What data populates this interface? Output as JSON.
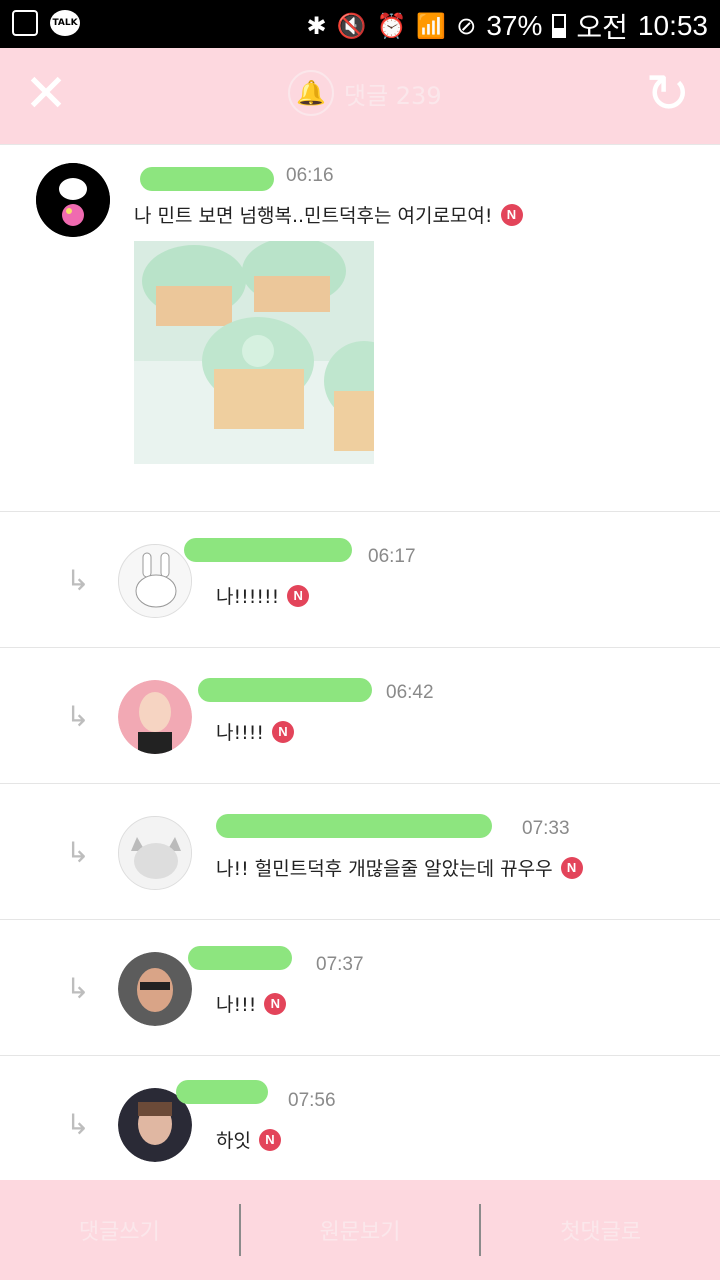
{
  "status_bar": {
    "battery": "37%",
    "ampm": "오전",
    "time": "10:53",
    "talk": "TALK"
  },
  "header": {
    "title": "댓글 239"
  },
  "comments": [
    {
      "time": "06:16",
      "text": "나 민트 보면 넘행복..민트덕후는 여기로모여!",
      "badge": "N"
    },
    {
      "time": "06:17",
      "text": "나!!!!!!",
      "badge": "N"
    },
    {
      "time": "06:42",
      "text": "나!!!!",
      "badge": "N"
    },
    {
      "time": "07:33",
      "text": "나!! 헐민트덕후 개많을줄 알았는데 뀨우우",
      "badge": "N"
    },
    {
      "time": "07:37",
      "text": "나!!!",
      "badge": "N"
    },
    {
      "time": "07:56",
      "text": "하잇",
      "badge": "N"
    }
  ],
  "bottom_bar": {
    "write": "댓글쓰기",
    "original": "원문보기",
    "first": "첫댓글로"
  },
  "colors": {
    "accent": "#fdd8df",
    "badge": "#e3445a",
    "blur": "#8de57f"
  }
}
